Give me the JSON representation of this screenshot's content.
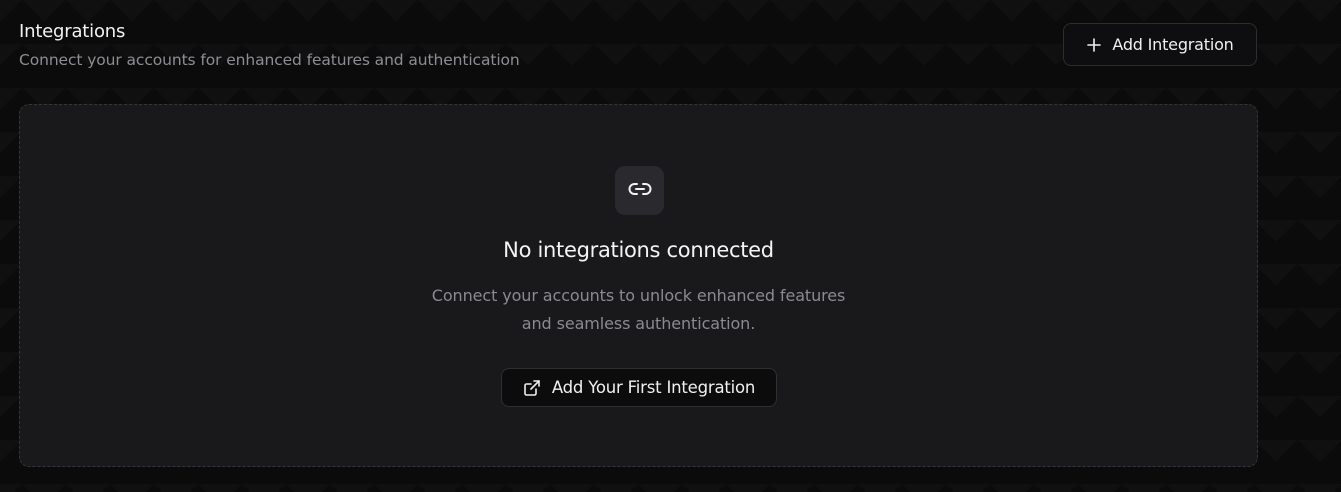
{
  "header": {
    "title": "Integrations",
    "subtitle": "Connect your accounts for enhanced features and authentication"
  },
  "toolbar": {
    "add_label": "Add Integration",
    "add_icon": "plus-icon"
  },
  "empty_state": {
    "icon": "link-icon",
    "title": "No integrations connected",
    "description": "Connect your accounts to unlock enhanced features and seamless authentication.",
    "button_label": "Add Your First Integration",
    "button_icon": "external-link-icon"
  },
  "colors": {
    "background": "#0b0b0c",
    "panel": "#19191b",
    "panel_border": "#34343a",
    "icon_tile": "#2a2a2e",
    "muted_text": "#8a8a91",
    "primary_text": "#f2f2f4"
  }
}
